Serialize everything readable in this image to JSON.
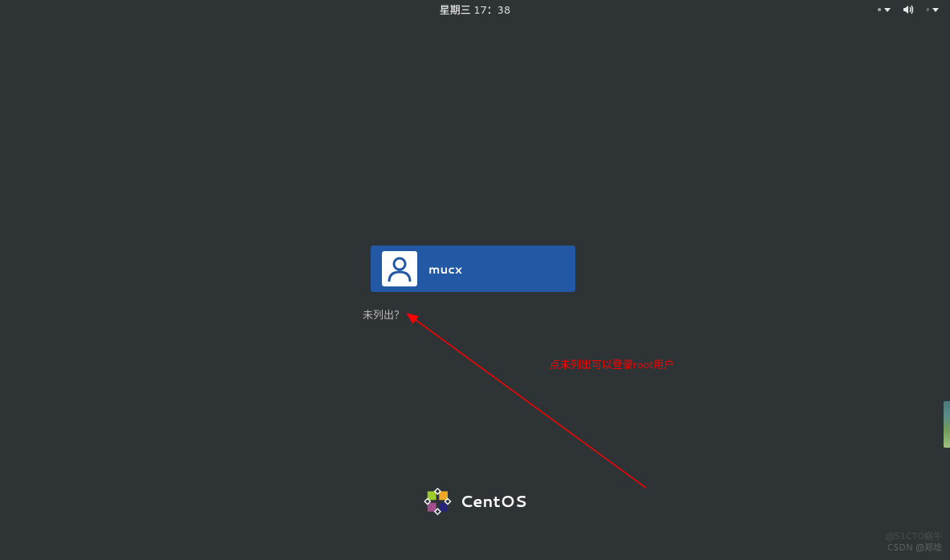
{
  "topbar": {
    "datetime": "星期三 17：38"
  },
  "login": {
    "username": "mucx",
    "not_listed_label": "未列出？"
  },
  "branding": {
    "os_name": "CentOS"
  },
  "annotation": {
    "text": "点未列出可以登录root用户"
  },
  "watermarks": {
    "bottom_right": "CSDN @郑埝",
    "faint": "@51CTO蜗牛"
  },
  "icons": {
    "accessibility": "accessibility-icon",
    "volume": "volume-icon",
    "power": "power-icon"
  }
}
